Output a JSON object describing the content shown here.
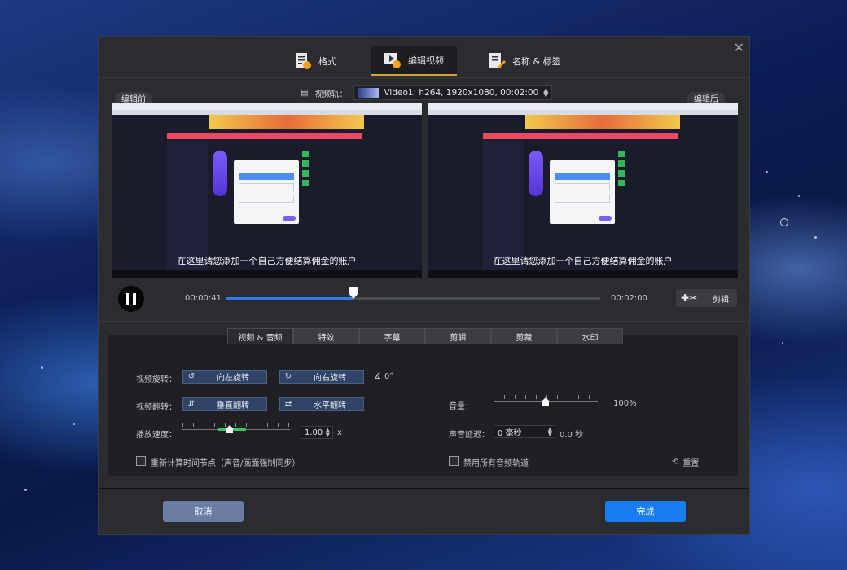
{
  "tabs": [
    {
      "label": "格式",
      "icon": "format-doc-icon"
    },
    {
      "label": "编辑视频",
      "icon": "video-edit-icon"
    },
    {
      "label": "名称 & 标签",
      "icon": "name-tag-icon"
    }
  ],
  "track": {
    "label": "视频轨：",
    "value": "Video1: h264, 1920x1080, 00:02:00"
  },
  "preview": {
    "before_label": "编辑前",
    "after_label": "编辑后",
    "subtitle": "在这里请您添加一个自己方便结算佣金的账户"
  },
  "player": {
    "current_time": "00:00:41",
    "total_time": "00:02:00",
    "progress": 0.34,
    "cut_label": "剪辑"
  },
  "sub_tabs": [
    "视频 & 音频",
    "特效",
    "字幕",
    "剪辑",
    "剪裁",
    "水印"
  ],
  "settings": {
    "rotate_label": "视频旋转：",
    "rotate_left": "向左旋转",
    "rotate_right": "向右旋转",
    "rotate_value": "0°",
    "flip_label": "视频翻转：",
    "flip_vertical": "垂直翻转",
    "flip_horizontal": "水平翻转",
    "speed_label": "播放速度：",
    "speed_value": "1.00",
    "speed_unit": "x",
    "recalc_label": "重新计算时间节点（声音/画面强制同步）",
    "volume_label": "音量：",
    "volume_value": "100%",
    "volume_level": 0.5,
    "delay_label": "声音延迟：",
    "delay_value": "0 毫秒",
    "delay_seconds": "0.0 秒",
    "mute_label": "禁用所有音频轨道",
    "reset_label": "重置"
  },
  "footer": {
    "cancel": "取消",
    "done": "完成"
  },
  "colors": {
    "accent": "#1a7cf3",
    "progress": "#2c7cf6",
    "tab_underline": "#d9a13a"
  }
}
